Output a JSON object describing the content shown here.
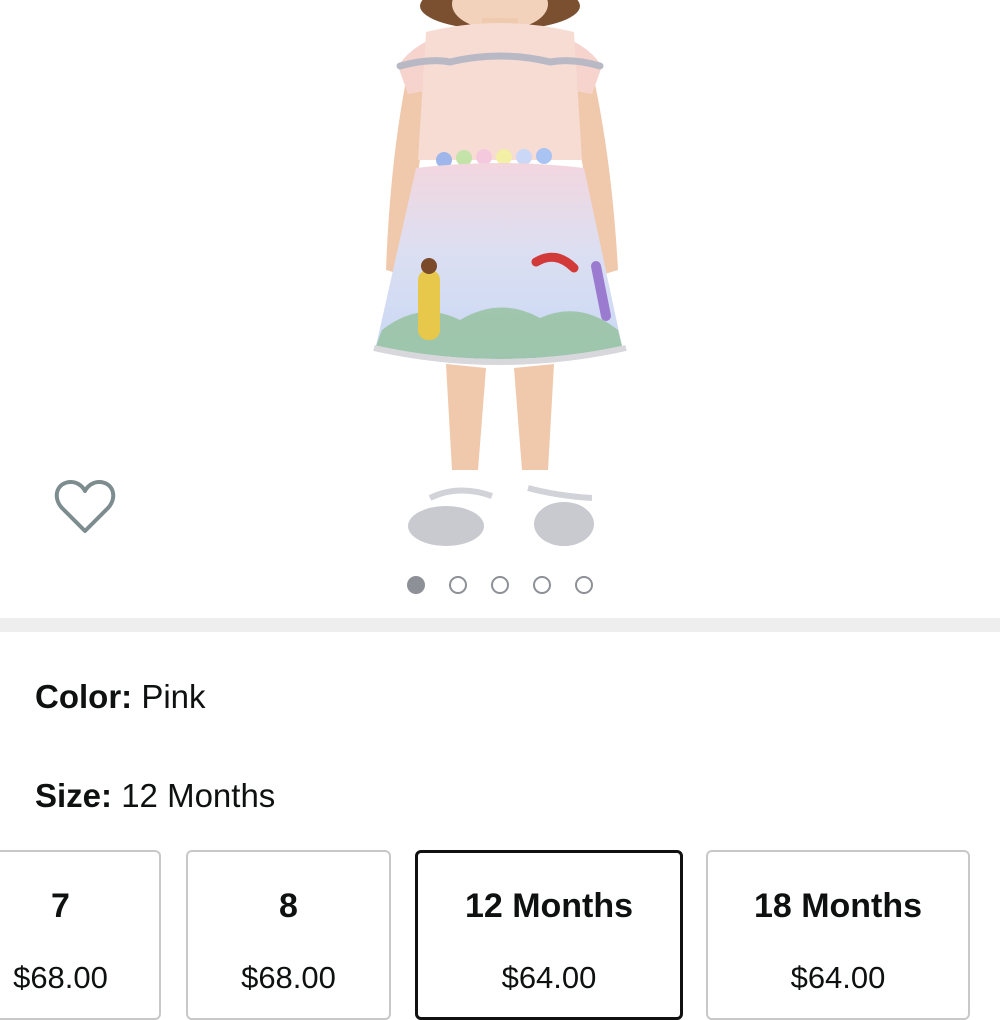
{
  "gallery": {
    "image_count": 5,
    "active_index": 0
  },
  "icons": {
    "wishlist": "heart-outline-icon"
  },
  "variation": {
    "color": {
      "key": "Color:",
      "value": "Pink"
    },
    "size": {
      "key": "Size:",
      "value": "12 Months"
    }
  },
  "sizes": [
    {
      "name": "7",
      "price": "$68.00",
      "selected": false
    },
    {
      "name": "8",
      "price": "$68.00",
      "selected": false
    },
    {
      "name": "12 Months",
      "price": "$64.00",
      "selected": true
    },
    {
      "name": "18 Months",
      "price": "$64.00",
      "selected": false
    }
  ],
  "colors": {
    "selected_border": "#111111",
    "tile_border": "#c8c8c8",
    "dot": "#8d9096",
    "separator": "#eeeeee"
  }
}
